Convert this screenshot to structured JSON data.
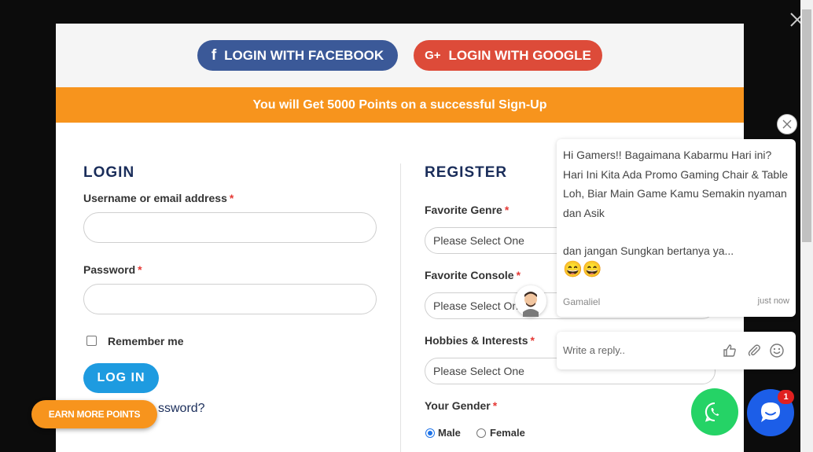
{
  "social": {
    "facebook_label": "LOGIN WITH FACEBOOK",
    "facebook_icon": "facebook-icon",
    "google_label": "LOGIN WITH GOOGLE",
    "google_icon": "google-plus-icon",
    "facebook_color": "#3b5998",
    "google_color": "#dd4b39"
  },
  "points_banner": "You will Get 5000 Points on a successful Sign-Up",
  "login": {
    "title": "LOGIN",
    "username_label": "Username or email address",
    "username_value": "",
    "password_label": "Password",
    "password_value": "",
    "required_mark": "*",
    "remember_label": "Remember me",
    "remember_checked": false,
    "button_label": "LOG IN",
    "lost_password": "ssword?"
  },
  "register": {
    "title": "REGISTER",
    "genre_label": "Favorite Genre",
    "genre_value": "Please Select One",
    "console_label": "Favorite Console",
    "console_value": "Please Select On",
    "hobbies_label": "Hobbies & Interests",
    "hobbies_value": "Please Select One",
    "gender_label": "Your Gender",
    "gender_options": [
      "Male",
      "Female"
    ],
    "gender_selected": "Male"
  },
  "earn_points": "EARN MORE POINTS",
  "chat": {
    "message_line1": "Hi Gamers!! Bagaimana Kabarmu Hari ini? Hari Ini Kita Ada Promo Gaming Chair & Table Loh, Biar Main Game Kamu Semakin nyaman dan Asik",
    "message_line2": "dan jangan Sungkan bertanya ya...",
    "emoji": "😄😄",
    "author": "Gamaliel",
    "time": "just now",
    "reply_placeholder": "Write a reply..",
    "unread_count": "1"
  },
  "colors": {
    "accent_orange": "#f7941d",
    "login_blue": "#1e9be0",
    "title_navy": "#1a2d5a",
    "whatsapp_green": "#25d366",
    "messenger_blue": "#1c5ee8"
  }
}
